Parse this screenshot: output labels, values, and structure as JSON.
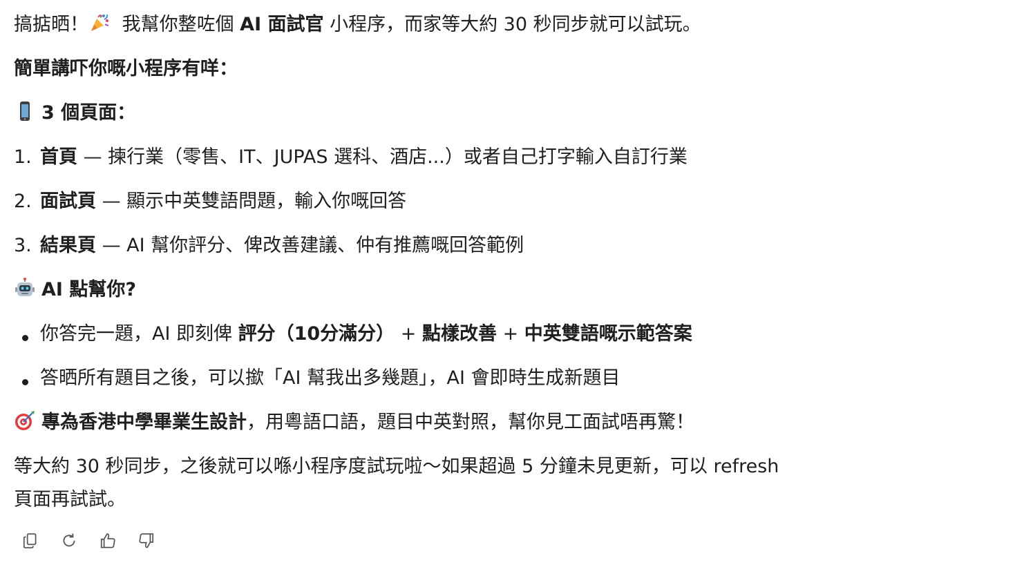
{
  "intro": {
    "part1": "搞掂晒！",
    "part2": " 我幫你整咗個 ",
    "bold": "AI 面試官",
    "part3": " 小程序，而家等大約 30 秒同步就可以試玩。"
  },
  "summary_heading": "簡單講吓你嘅小程序有咩：",
  "pages_heading": "3 個頁面：",
  "pages": [
    {
      "num": "1.",
      "title": "首頁",
      "desc": " — 揀行業（零售、IT、JUPAS 選科、酒店...）或者自己打字輸入自訂行業"
    },
    {
      "num": "2.",
      "title": "面試頁",
      "desc": " — 顯示中英雙語問題，輸入你嘅回答"
    },
    {
      "num": "3.",
      "title": "結果頁",
      "desc": " — AI 幫你評分、俾改善建議、仲有推薦嘅回答範例"
    }
  ],
  "ai_heading": "AI 點幫你?",
  "ai_bullets": [
    {
      "text1": "你答完一題，AI 即刻俾 ",
      "bold1": "評分（10分滿分）",
      "text2": " + ",
      "bold2": "點樣改善",
      "text3": " + ",
      "bold3": "中英雙語嘅示範答案"
    },
    {
      "text1": "答晒所有題目之後，可以撳「AI 幫我出多幾題」，AI 會即時生成新題目"
    }
  ],
  "target": {
    "bold": "專為香港中學畢業生設計",
    "text": "，用粵語口語，題目中英對照，幫你見工面試唔再驚！"
  },
  "footer": {
    "line1": "等大約 30 秒同步，之後就可以喺小程序度試玩啦～如果超過 5 分鐘未見更新，可以 refresh",
    "line2": "頁面再試試。"
  },
  "icons": {
    "party": "party-popper-icon",
    "phone": "mobile-phone-icon",
    "robot": "robot-icon",
    "target": "target-dart-icon",
    "copy": "copy-icon",
    "regenerate": "regenerate-icon",
    "like": "thumbs-up-icon",
    "dislike": "thumbs-down-icon"
  }
}
